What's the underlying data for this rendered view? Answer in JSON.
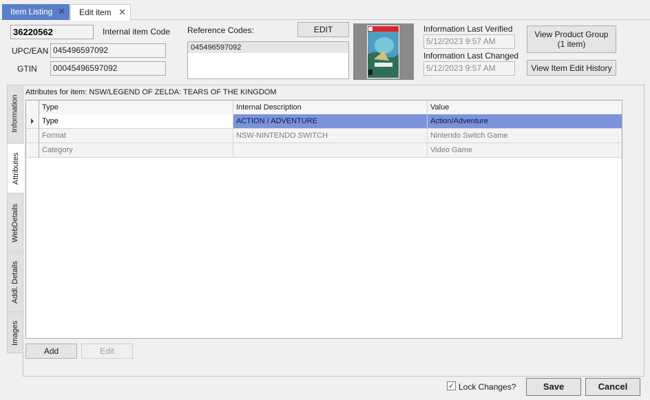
{
  "tabs": {
    "listing_label": "Item Listing",
    "edit_label": "Edit item",
    "close_glyph": "✕"
  },
  "header": {
    "item_code": "36220562",
    "item_code_label": "Internal item Code",
    "upc_label": "UPC/EAN",
    "upc_value": "045496597092",
    "gtin_label": "GTIN",
    "gtin_value": "00045496597092",
    "reference_codes_label": "Reference Codes:",
    "reference_codes": [
      "045496597092"
    ],
    "edit_button": "EDIT",
    "last_verified_label": "Information Last Verified",
    "last_verified_value": "5/12/2023 9:57 AM",
    "last_changed_label": "Information Last Changed",
    "last_changed_value": "5/12/2023 9:57 AM",
    "view_product_group_line1": "View Product Group",
    "view_product_group_line2": "(1 item)",
    "view_history_button": "View Item Edit History"
  },
  "side_tabs": [
    "Information",
    "Attributes",
    "WebDetails",
    "Addl. Details",
    "Images"
  ],
  "attributes": {
    "title_prefix": "Attributes for item:",
    "item_name": "NSW/LEGEND OF ZELDA: TEARS OF THE KINGDOM",
    "columns": [
      "Type",
      "Internal Description",
      "Value"
    ],
    "rows": [
      {
        "type": "Type",
        "internal": "ACTION / ADVENTURE",
        "value": "Action/Adventure"
      },
      {
        "type": "Format",
        "internal": "NSW-NINTENDO SWITCH",
        "value": "Nintendo Switch Game"
      },
      {
        "type": "Category",
        "internal": "",
        "value": "Video Game"
      }
    ],
    "add_button": "Add",
    "edit_button": "Edit"
  },
  "footer": {
    "lock_label": "Lock Changes?",
    "lock_checked": true,
    "save_button": "Save",
    "cancel_button": "Cancel"
  },
  "colors": {
    "tab_inactive": "#5b7fc8",
    "selection": "#7b93dc"
  }
}
